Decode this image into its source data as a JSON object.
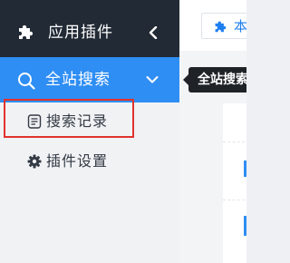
{
  "sidebar": {
    "header": {
      "icon": "puzzle-icon",
      "title": "应用插件",
      "collapse_icon": "chevron-left-icon"
    },
    "active_menu": {
      "icon": "search-icon",
      "label": "全站搜索",
      "chevron_icon": "chevron-down-icon"
    },
    "submenu": [
      {
        "icon": "list-document-icon",
        "label": "搜索记录"
      },
      {
        "icon": "gear-icon",
        "label": "插件设置"
      }
    ]
  },
  "main": {
    "top_button": {
      "icon": "puzzle-icon",
      "label": "本"
    }
  },
  "tooltip": {
    "text": "全站搜索"
  },
  "colors": {
    "sidebar_header_bg": "#222a35",
    "active_bg": "#2f8ef4",
    "accent": "#1f7ff0",
    "highlight_border": "#e0332d",
    "tooltip_bg": "#1f2328"
  }
}
